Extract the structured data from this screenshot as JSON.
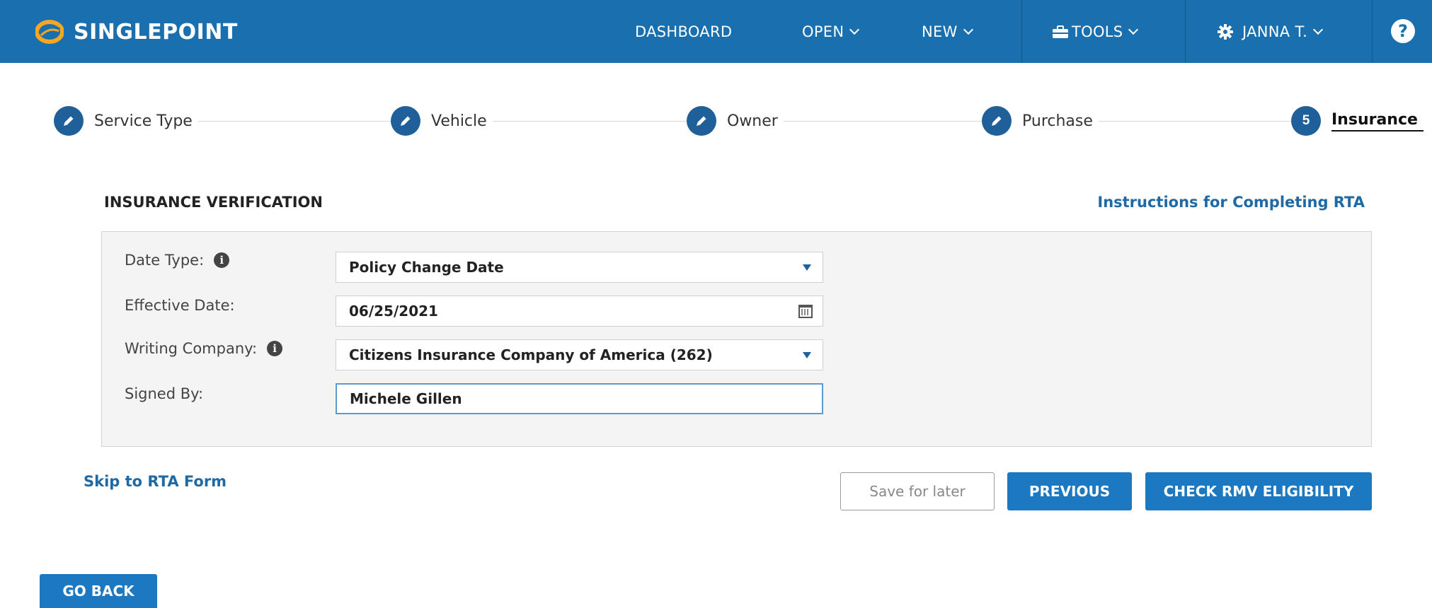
{
  "header": {
    "brand": "SINGLEPOINT",
    "nav": {
      "dashboard": "DASHBOARD",
      "open": "OPEN",
      "new": "NEW",
      "tools": "TOOLS",
      "user": "JANNA T."
    },
    "help_icon": "?"
  },
  "stepper": {
    "steps": [
      {
        "label": "Service Type",
        "state": "completed",
        "icon": "pencil-icon"
      },
      {
        "label": "Vehicle",
        "state": "completed",
        "icon": "pencil-icon"
      },
      {
        "label": "Owner",
        "state": "completed",
        "icon": "pencil-icon"
      },
      {
        "label": "Purchase",
        "state": "completed",
        "icon": "pencil-icon"
      },
      {
        "label": "Insurance",
        "state": "active",
        "number": "5"
      }
    ]
  },
  "section": {
    "title": "INSURANCE VERIFICATION",
    "instructions_link": "Instructions for Completing RTA"
  },
  "form": {
    "date_type": {
      "label": "Date Type:",
      "value": "Policy Change Date"
    },
    "effective_date": {
      "label": "Effective Date:",
      "value": "06/25/2021"
    },
    "writing_company": {
      "label": "Writing Company:",
      "value": "Citizens Insurance Company of America (262)"
    },
    "signed_by": {
      "label": "Signed By:",
      "value": "Michele Gillen"
    }
  },
  "actions": {
    "skip_link": "Skip to RTA Form",
    "save_for_later": "Save for later",
    "previous": "PREVIOUS",
    "check_eligibility": "CHECK RMV ELIGIBILITY",
    "go_back": "GO BACK"
  },
  "colors": {
    "header_bg": "#1a6fae",
    "step_circle": "#1f5f9a",
    "primary_button": "#1c78c0",
    "link": "#1f6aa5",
    "logo_orange": "#f5a623"
  }
}
